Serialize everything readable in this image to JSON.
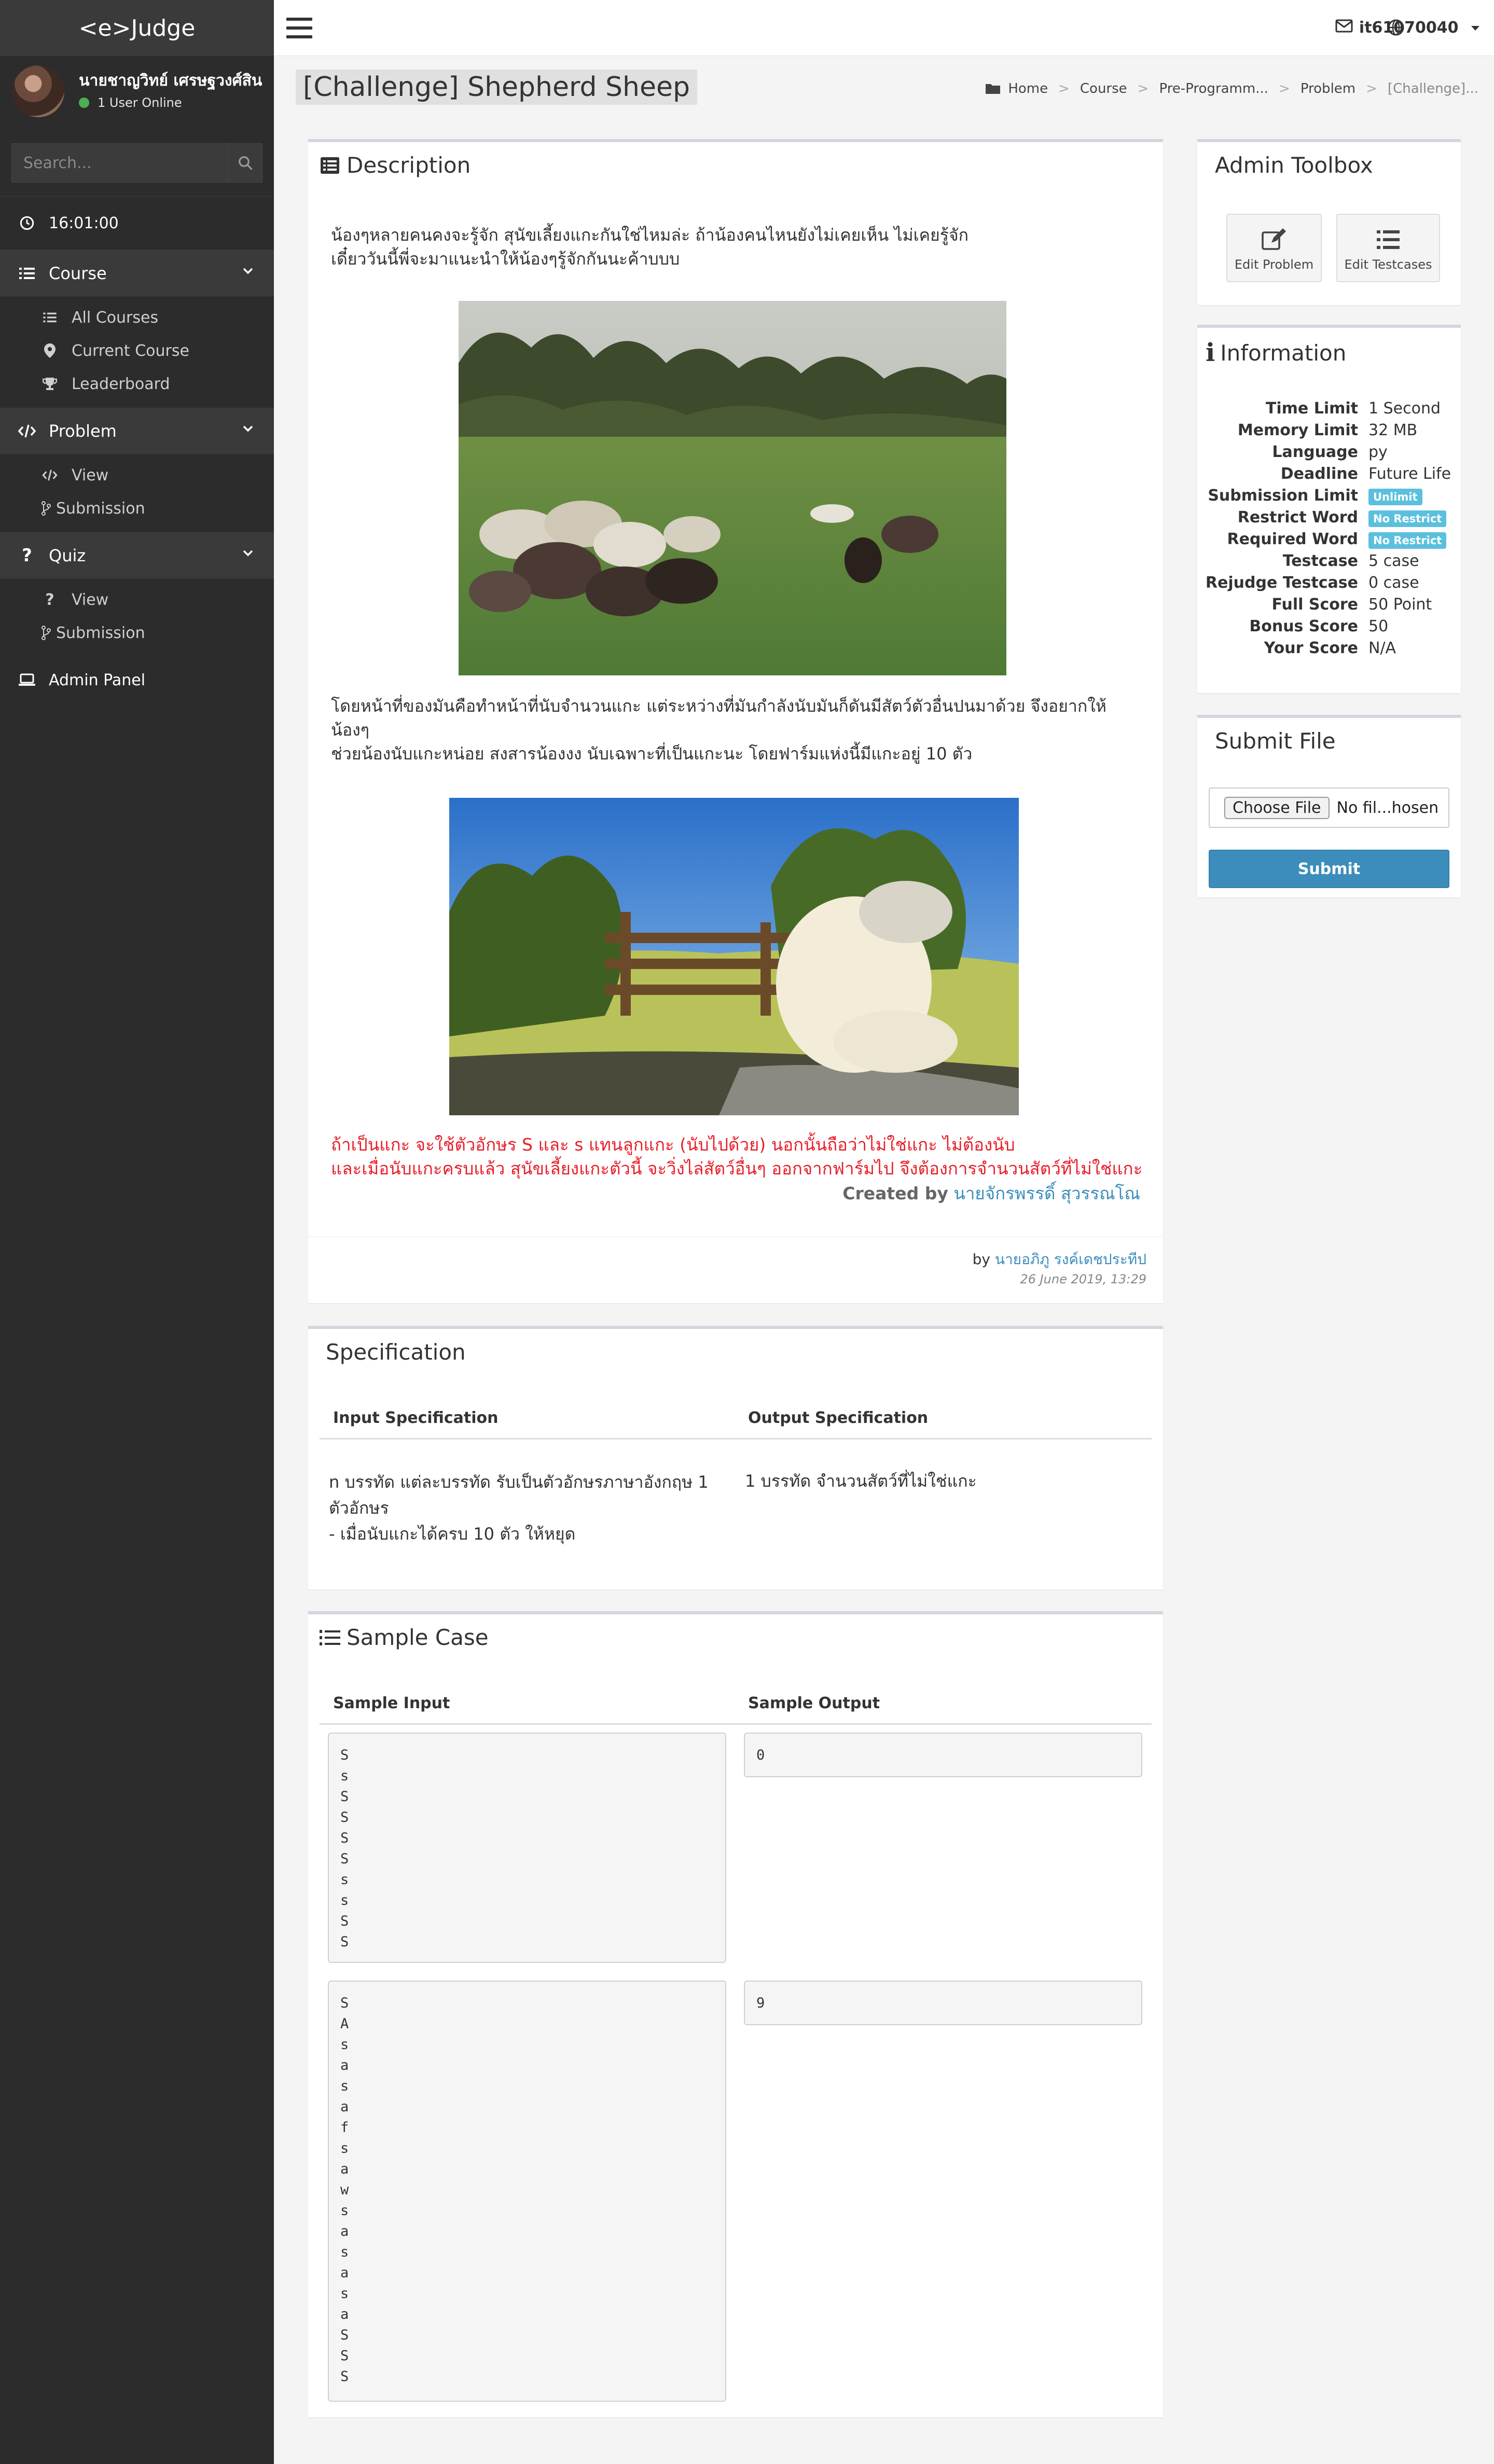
{
  "app": {
    "brand": "<e>Judge"
  },
  "user": {
    "name": "นายชาญวิทย์ เศรษฐวงศ์สิน",
    "online": "1 User Online",
    "top_username": "it61070040"
  },
  "search": {
    "placeholder": "Search..."
  },
  "clock": "16:01:00",
  "sidebar": {
    "course": {
      "label": "Course",
      "items": [
        "All Courses",
        "Current Course",
        "Leaderboard"
      ]
    },
    "problem": {
      "label": "Problem",
      "items": [
        "View",
        "Submission"
      ]
    },
    "quiz": {
      "label": "Quiz",
      "items": [
        "View",
        "Submission"
      ]
    },
    "admin": "Admin Panel"
  },
  "page": {
    "title": "[Challenge] Shepherd Sheep"
  },
  "breadcrumb": [
    "Home",
    "Course",
    "Pre-Programm...",
    "Problem",
    "[Challenge]..."
  ],
  "description": {
    "title": "Description",
    "para1_line1": "น้องๆหลายคนคงจะรู้จัก สุนัขเลี้ยงแกะกันใช่ไหมล่ะ ถ้าน้องคนไหนยังไม่เคยเห็น ไม่เคยรู้จัก",
    "para1_line2": "เดี๋ยววันนี้พี่จะมาแนะนำให้น้องๆรู้จักกันนะค้าบบบ",
    "para2_line1": "โดยหน้าที่ของมันคือทำหน้าที่นับจำนวนแกะ แต่ระหว่างที่มันกำลังนับมันก็ดันมีสัตว์ตัวอื่นปนมาด้วย จึงอยากให้",
    "para2_line2": "น้องๆ",
    "para2_line3": "ช่วยน้องนับแกะหน่อย สงสารน้องงง นับเฉพาะที่เป็นแกะนะ โดยฟาร์มแห่งนี้มีแกะอยู่ 10 ตัว",
    "red_line1": "ถ้าเป็นแกะ จะใช้ตัวอักษร S และ s แทนลูกแกะ (นับไปด้วย) นอกนั้นถือว่าไม่ใช่แกะ ไม่ต้องนับ",
    "red_line2": "และเมื่อนับแกะครบแล้ว สุนัขเลี้ยงแกะตัวนี้ จะวิ่งไล่สัตว์อื่นๆ ออกจากฟาร์มไป จึงต้องการจำนวนสัตว์ที่ไม่ใช่แกะ",
    "created_by_label": "Created by",
    "created_by_name": "นายจักรพรรดิ์ สุวรรณโณ",
    "by_label": "by",
    "author": "นายอภิภู รงค์เดชประทีป",
    "date": "26 June 2019, 13:29"
  },
  "specification": {
    "title": "Specification",
    "input_header": "Input Specification",
    "output_header": "Output Specification",
    "input_line1": "n บรรทัด แต่ละบรรทัด รับเป็นตัวอักษรภาษาอังกฤษ 1",
    "input_line2": "ตัวอักษร",
    "input_line3": "- เมื่อนับแกะได้ครบ 10 ตัว ให้หยุด",
    "output_text": "1 บรรทัด จำนวนสัตว์ที่ไม่ใช่แกะ"
  },
  "sample": {
    "title": "Sample Case",
    "input_header": "Sample Input",
    "output_header": "Sample Output",
    "case1_input": "S\ns\nS\nS\nS\nS\ns\ns\nS\nS",
    "case1_output": "0",
    "case2_input": "S\nA\ns\na\ns\na\nf\ns\na\nw\ns\na\ns\na\ns\na\nS\nS\nS",
    "case2_output": "9"
  },
  "toolbox": {
    "title": "Admin Toolbox",
    "edit_problem": "Edit Problem",
    "edit_testcases": "Edit Testcases"
  },
  "information": {
    "title": "Information",
    "rows": [
      {
        "label": "Time Limit",
        "value": "1 Second"
      },
      {
        "label": "Memory Limit",
        "value": "32 MB"
      },
      {
        "label": "Language",
        "value": "py"
      },
      {
        "label": "Deadline",
        "value": "Future Life"
      },
      {
        "label": "Submission Limit",
        "value": "Unlimit"
      },
      {
        "label": "Restrict Word",
        "value": "No Restrict"
      },
      {
        "label": "Required Word",
        "value": "No Restrict"
      },
      {
        "label": "Testcase",
        "value": "5 case"
      },
      {
        "label": "Rejudge Testcase",
        "value": "0 case"
      },
      {
        "label": "Full Score",
        "value": "50 Point"
      },
      {
        "label": "Bonus Score",
        "value": "50"
      },
      {
        "label": "Your Score",
        "value": "N/A"
      }
    ]
  },
  "submit": {
    "title": "Submit File",
    "choose_label": "Choose File",
    "file_status": "No fil...hosen",
    "button": "Submit"
  }
}
